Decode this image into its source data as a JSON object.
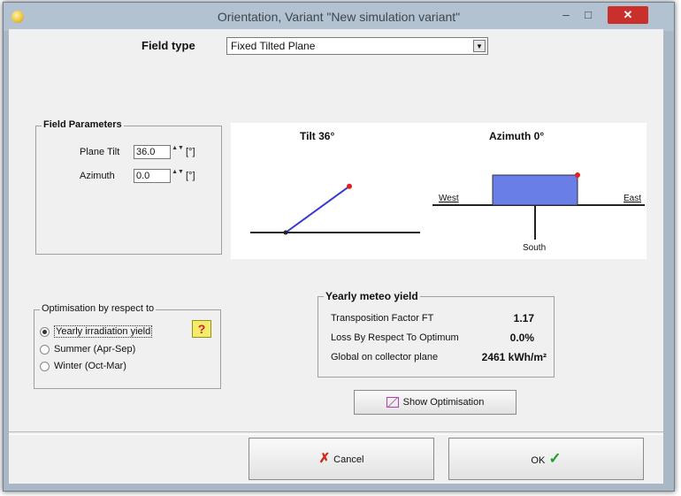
{
  "window": {
    "title": "Orientation, Variant \"New simulation variant\"",
    "minimize_glyph": "–",
    "maximize_glyph": "□",
    "close_glyph": "✕"
  },
  "field_type": {
    "label": "Field type",
    "selected": "Fixed Tilted Plane",
    "arrow_glyph": "▼"
  },
  "field_parameters": {
    "title": "Field Parameters",
    "plane_tilt_label": "Plane Tilt",
    "plane_tilt_value": "36.0",
    "azimuth_label": "Azimuth",
    "azimuth_value": "0.0",
    "unit": "[°]",
    "spin_glyph": "▲▼"
  },
  "diagram": {
    "tilt_label": "Tilt 36°",
    "azimuth_label": "Azimuth 0°",
    "west": "West",
    "east": "East",
    "south": "South",
    "tilt_deg": 36,
    "azimuth_deg": 0
  },
  "optimisation": {
    "title": "Optimisation by respect to",
    "options": [
      {
        "label": "Yearly irradiation yield",
        "selected": true
      },
      {
        "label": "Summer (Apr-Sep)",
        "selected": false
      },
      {
        "label": "Winter (Oct-Mar)",
        "selected": false
      }
    ],
    "help_glyph": "?"
  },
  "yearly_yield": {
    "title": "Yearly meteo yield",
    "rows": [
      {
        "label": "Transposition Factor FT",
        "value": "1.17"
      },
      {
        "label": "Loss By Respect To Optimum",
        "value": "0.0%"
      },
      {
        "label": "Global on collector plane",
        "value": "2461 kWh/m²"
      }
    ]
  },
  "buttons": {
    "show_optimisation": "Show Optimisation",
    "cancel": "Cancel",
    "ok": "OK"
  },
  "colors": {
    "titlebar": "#b3c2d0",
    "close_button": "#c9302c",
    "plane_line": "#3a3ad0",
    "module_fill": "#6a7ee8",
    "marker_red": "#e02020"
  }
}
